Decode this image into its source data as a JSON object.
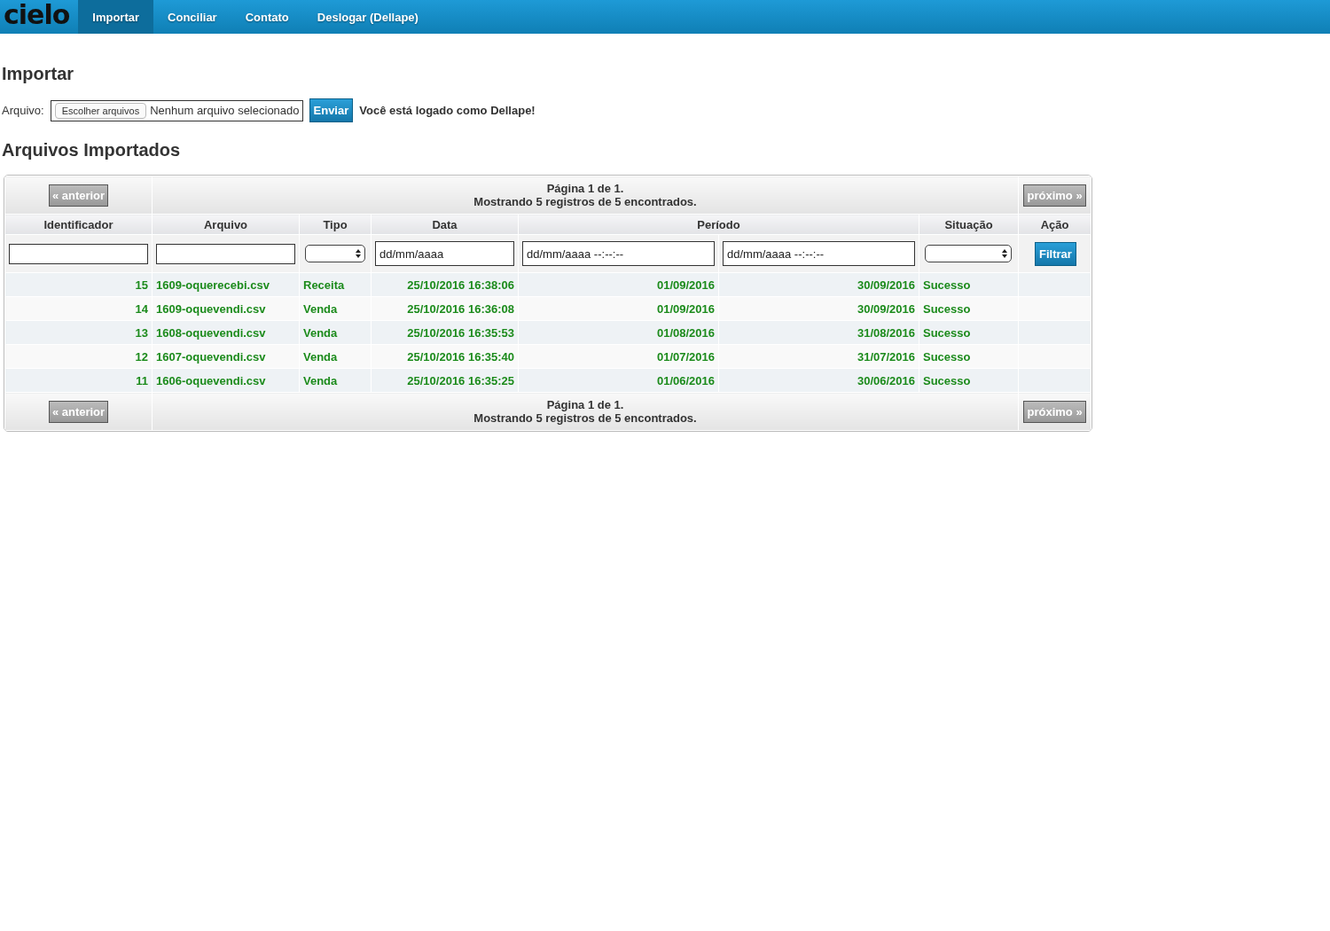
{
  "nav": {
    "logo": "cielo",
    "items": [
      {
        "label": "Importar",
        "selected": true
      },
      {
        "label": "Conciliar",
        "selected": false
      },
      {
        "label": "Contato",
        "selected": false
      },
      {
        "label": "Deslogar (Dellape)",
        "selected": false
      }
    ]
  },
  "title": "Importar",
  "upload": {
    "label": "Arquivo:",
    "choose_button": "Escolher arquivos",
    "file_status": "Nenhum arquivo selecionado",
    "submit": "Enviar",
    "login_note": "Você está logado como Dellape!"
  },
  "section_title": "Arquivos Importados",
  "pager_top": {
    "previous": {
      "label": "« anterior",
      "disabled": true
    },
    "page": "Página 1 de 1.",
    "summary": "Mostrando 5 registros de 5 encontrados.",
    "next": {
      "label": "próximo »",
      "disabled": true
    }
  },
  "table": {
    "columns": [
      "Identificador",
      "Arquivo",
      "Tipo",
      "Data",
      "Período",
      "Situação",
      "Ação"
    ],
    "filters": [
      {
        "kind": "text"
      },
      {
        "kind": "text"
      },
      {
        "kind": "select"
      },
      {
        "kind": "date",
        "placeholder": "dd/mm/aaaa"
      },
      {
        "kind": "date",
        "placeholder": "dd/mm/aaaa --:--:--"
      },
      {
        "kind": "date",
        "placeholder": "dd/mm/aaaa --:--:--"
      },
      {
        "kind": "select"
      },
      {
        "kind": "button",
        "label": "Filtrar"
      }
    ],
    "rows": [
      {
        "id": "15",
        "file": "1609-oquerecebi.csv",
        "type": "Receita",
        "date": "25/10/2016 16:38:06",
        "start": "01/09/2016",
        "end": "30/09/2016",
        "status": "Sucesso"
      },
      {
        "id": "14",
        "file": "1609-oquevendi.csv",
        "type": "Venda",
        "date": "25/10/2016 16:36:08",
        "start": "01/09/2016",
        "end": "30/09/2016",
        "status": "Sucesso"
      },
      {
        "id": "13",
        "file": "1608-oquevendi.csv",
        "type": "Venda",
        "date": "25/10/2016 16:35:53",
        "start": "01/08/2016",
        "end": "31/08/2016",
        "status": "Sucesso"
      },
      {
        "id": "12",
        "file": "1607-oquevendi.csv",
        "type": "Venda",
        "date": "25/10/2016 16:35:40",
        "start": "01/07/2016",
        "end": "31/07/2016",
        "status": "Sucesso"
      },
      {
        "id": "11",
        "file": "1606-oquevendi.csv",
        "type": "Venda",
        "date": "25/10/2016 16:35:25",
        "start": "01/06/2016",
        "end": "30/06/2016",
        "status": "Sucesso"
      }
    ]
  },
  "pager_bottom": {
    "previous": {
      "label": "« anterior",
      "disabled": true
    },
    "page": "Página 1 de 1.",
    "summary": "Mostrando 5 registros de 5 encontrados.",
    "next": {
      "label": "próximo »",
      "disabled": true
    }
  }
}
